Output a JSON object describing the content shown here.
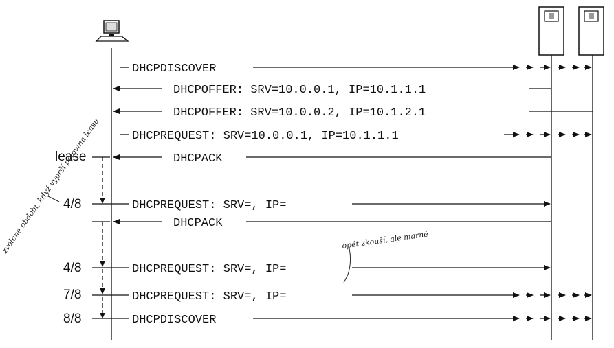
{
  "messages": [
    {
      "label": "DHCPDISCOVER"
    },
    {
      "label": "DHCPOFFER: SRV=10.0.0.1, IP=10.1.1.1"
    },
    {
      "label": "DHCPOFFER: SRV=10.0.0.2, IP=10.1.2.1"
    },
    {
      "label": "DHCPREQUEST: SRV=10.0.0.1, IP=10.1.1.1"
    },
    {
      "label": "DHCPACK"
    },
    {
      "label": "DHCPREQUEST: SRV=, IP="
    },
    {
      "label": "DHCPACK"
    },
    {
      "label": "DHCPREQUEST: SRV=, IP="
    },
    {
      "label": "DHCPREQUEST: SRV=, IP="
    },
    {
      "label": "DHCPDISCOVER"
    }
  ],
  "timers": {
    "lease": "lease",
    "t1": "4/8",
    "t1b": "4/8",
    "t2": "7/8",
    "t3": "8/8"
  },
  "notes": {
    "handwritten_left": "zvolené období, když vyprší polovina leasu",
    "handwritten_top": "opět zkouší, ale marně"
  },
  "icons": [
    "client-computer-icon",
    "server-1-icon",
    "server-2-icon"
  ]
}
